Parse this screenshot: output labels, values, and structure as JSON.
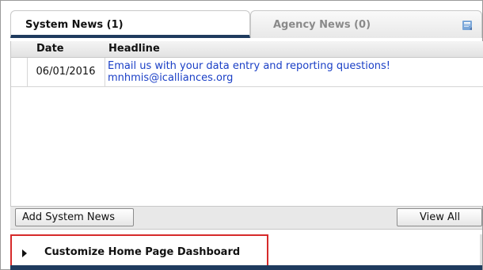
{
  "tabs": [
    {
      "label": "System News (1)",
      "active": true
    },
    {
      "label": "Agency News (0)",
      "active": false
    }
  ],
  "table": {
    "headers": {
      "date": "Date",
      "headline": "Headline"
    },
    "rows": [
      {
        "date": "06/01/2016",
        "headline_line1": "Email us with your data entry and reporting questions!",
        "headline_line2": "mnhmis@icalliances.org"
      }
    ]
  },
  "buttons": {
    "add": "Add System News",
    "view_all": "View All"
  },
  "customize": {
    "label": "Customize Home Page Dashboard"
  },
  "colors": {
    "accent": "#1f3b5e",
    "link": "#1a3fc6",
    "highlight": "#d62a2a"
  }
}
